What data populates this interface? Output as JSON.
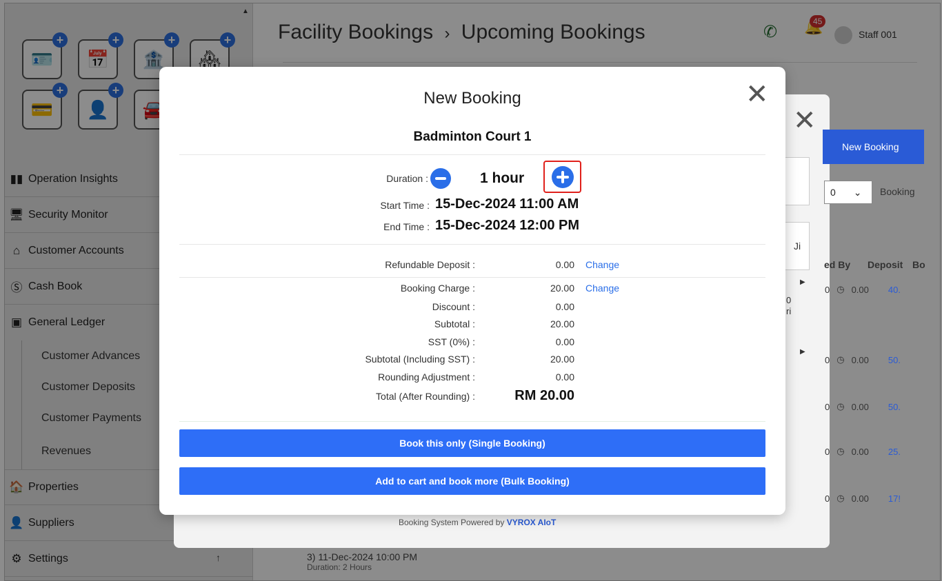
{
  "header": {
    "title": "Facility Bookings",
    "breadcrumb_sep": "›",
    "subtitle": "Upcoming Bookings",
    "notification_count": "45",
    "user_name": "Staff 001"
  },
  "sidebar": {
    "menu": [
      {
        "label": "Operation Insights",
        "icon": "bar-chart-icon"
      },
      {
        "label": "Security Monitor",
        "icon": "monitor-icon"
      },
      {
        "label": "Customer Accounts",
        "icon": "home-icon"
      },
      {
        "label": "Cash Book",
        "icon": "dollar-icon"
      },
      {
        "label": "General Ledger",
        "icon": "ledger-icon"
      }
    ],
    "submenu": [
      "Customer Advances",
      "Customer Deposits",
      "Customer Payments",
      "Revenues"
    ],
    "menu2": [
      {
        "label": "Properties",
        "icon": "house-icon"
      },
      {
        "label": "Suppliers",
        "icon": "person-icon"
      },
      {
        "label": "Settings",
        "icon": "gear-icon"
      }
    ],
    "scroll_up": "↑"
  },
  "background": {
    "new_booking_label": "New Booking",
    "select_value": "0",
    "booking_label": "Booking",
    "tab_fragment": "Ji",
    "columns": [
      "ed By",
      "Deposit",
      "Bo"
    ],
    "cell_lines": [
      "0",
      "ri"
    ],
    "rows": [
      {
        "by": "0",
        "deposit": "0.00",
        "amount": "40."
      },
      {
        "by": "0",
        "deposit": "0.00",
        "amount": "50."
      },
      {
        "by": "0",
        "deposit": "0.00",
        "amount": "50."
      },
      {
        "by": "0",
        "deposit": "0.00",
        "amount": "25."
      },
      {
        "by": "0",
        "deposit": "0.00",
        "amount": "17!"
      }
    ],
    "footer_text": "Booking System Powered by",
    "footer_brand": "VYROX AIoT",
    "bottom_item": "3) 11-Dec-2024 10:00 PM",
    "bottom_duration": "Duration: 2 Hours"
  },
  "modal": {
    "title": "New Booking",
    "facility": "Badminton Court 1",
    "duration_label": "Duration :",
    "duration_value": "1 hour",
    "start_label": "Start Time :",
    "start_value": "15-Dec-2024 11:00 AM",
    "end_label": "End Time :",
    "end_value": "15-Dec-2024 12:00 PM",
    "deposit": {
      "label": "Refundable Deposit :",
      "value": "0.00",
      "link": "Change"
    },
    "charges": [
      {
        "label": "Booking Charge :",
        "value": "20.00",
        "link": "Change"
      },
      {
        "label": "Discount :",
        "value": "0.00"
      },
      {
        "label": "Subtotal :",
        "value": "20.00"
      },
      {
        "label": "SST (0%) :",
        "value": "0.00"
      },
      {
        "label": "Subtotal (Including SST) :",
        "value": "20.00"
      },
      {
        "label": "Rounding Adjustment :",
        "value": "0.00"
      }
    ],
    "total": {
      "label": "Total (After Rounding) :",
      "value": "RM 20.00"
    },
    "single_booking_label": "Book this only (Single Booking)",
    "bulk_booking_label": "Add to cart and book more (Bulk Booking)"
  }
}
